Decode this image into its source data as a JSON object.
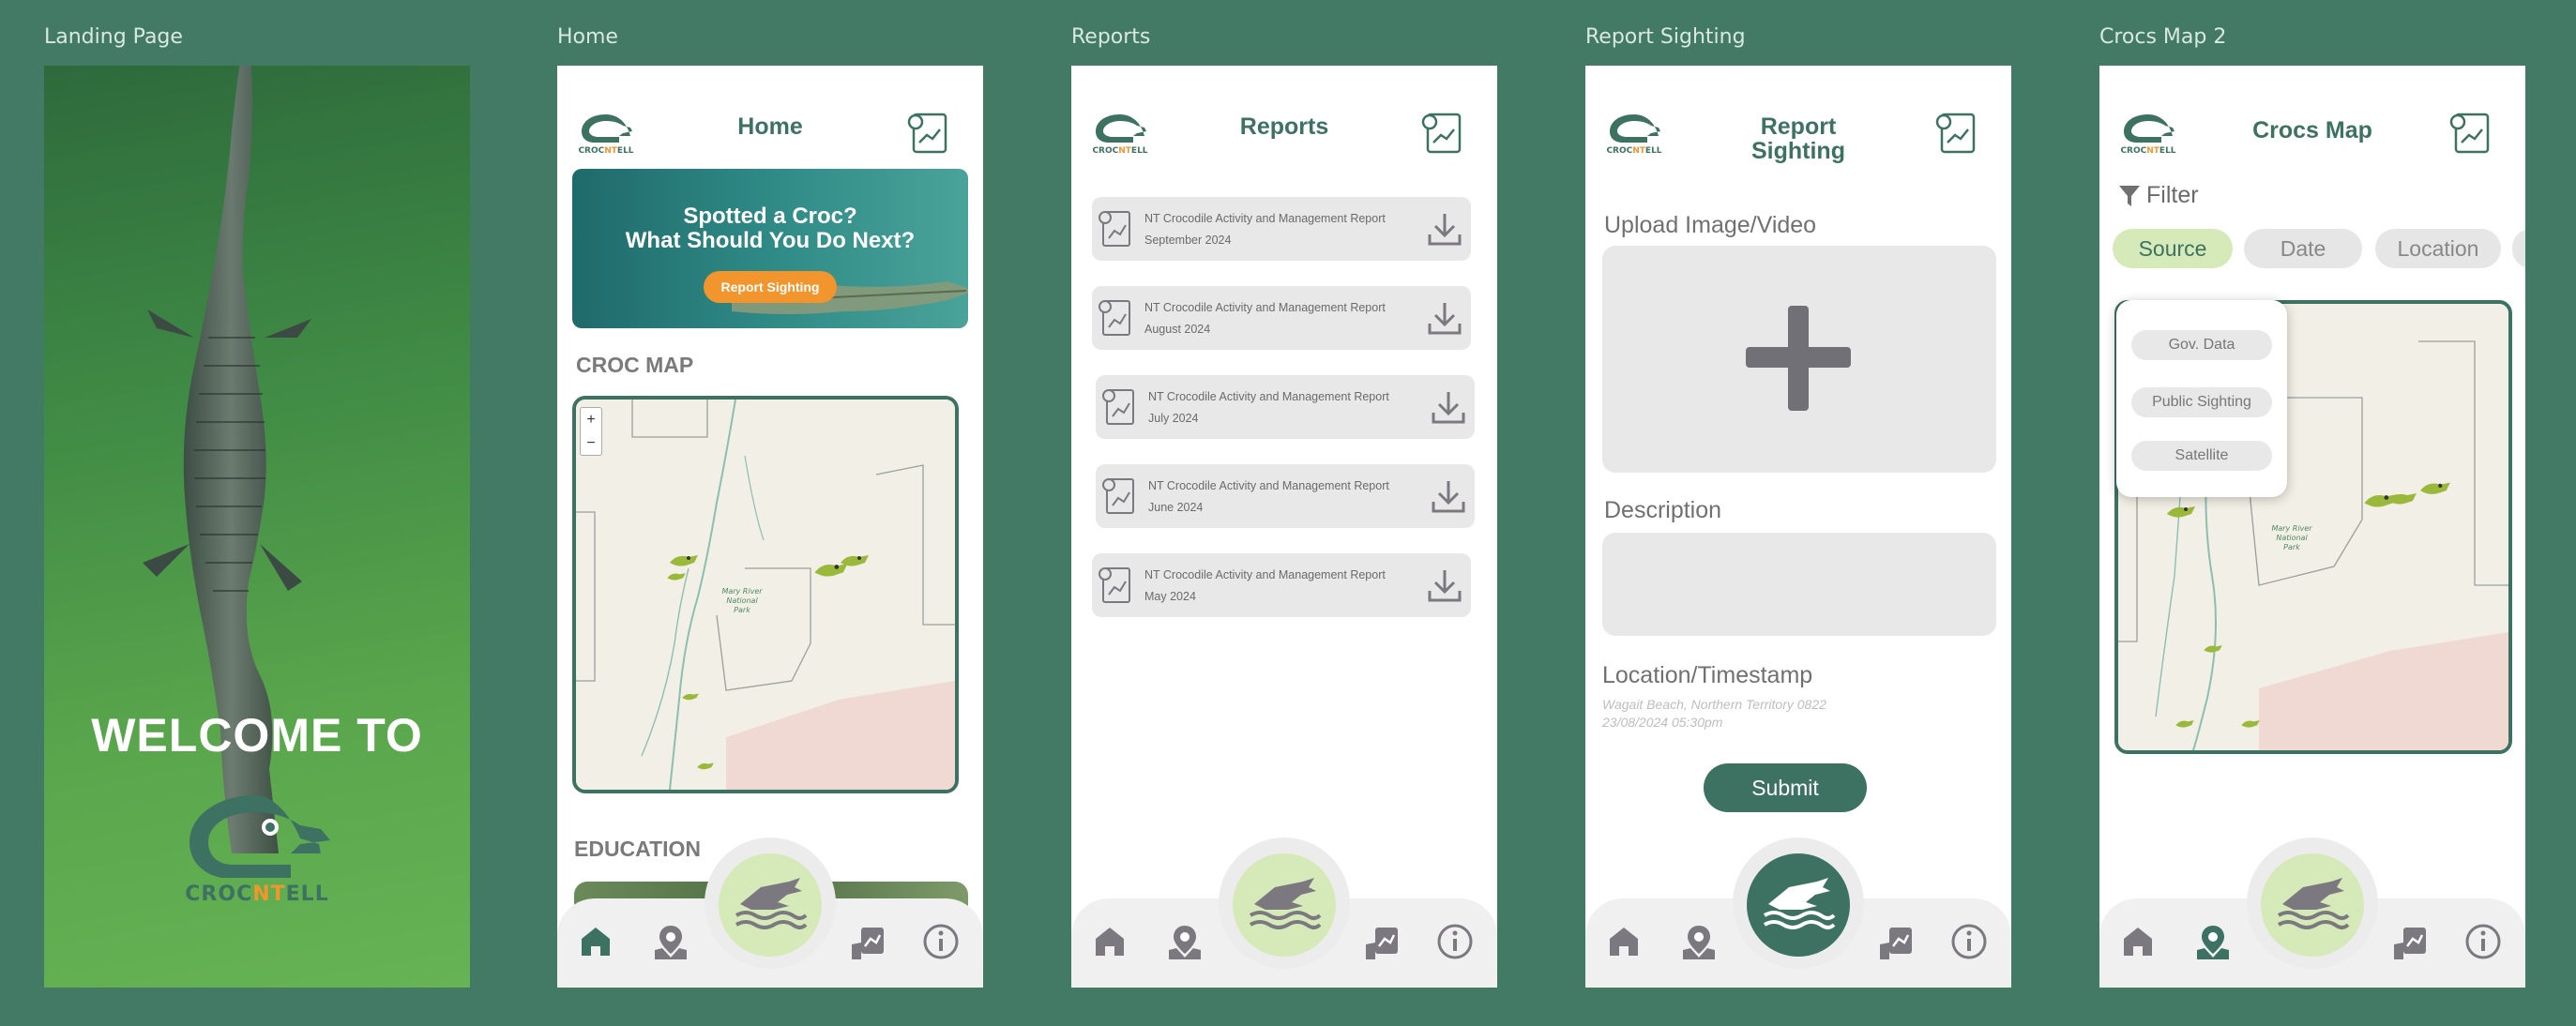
{
  "frames": {
    "landing": {
      "label": "Landing Page",
      "welcome": "WELCOME TO",
      "logo": "croc-nt-ell-logo"
    },
    "home": {
      "label": "Home",
      "title": "Home",
      "banner": {
        "line1": "Spotted a Croc?",
        "line2": "What Should You Do Next?",
        "button": "Report Sighting"
      },
      "croc_map_title": "CROC MAP",
      "map": {
        "zoom_in": "+",
        "zoom_out": "−",
        "park_label": "Mary River National Park"
      },
      "education_title": "EDUCATION"
    },
    "reports": {
      "label": "Reports",
      "title": "Reports",
      "items": [
        {
          "title": "NT Crocodile Activity and Management Report",
          "date": "September 2024"
        },
        {
          "title": "NT Crocodile Activity and Management Report",
          "date": "August 2024"
        },
        {
          "title": "NT Crocodile Activity and Management Report",
          "date": "July 2024"
        },
        {
          "title": "NT Crocodile Activity and Management Report",
          "date": "June 2024"
        },
        {
          "title": "NT Crocodile Activity and Management Report",
          "date": "May 2024"
        }
      ]
    },
    "report_sighting": {
      "label": "Report Sighting",
      "title_line1": "Report",
      "title_line2": "Sighting",
      "upload_label": "Upload Image/Video",
      "description_label": "Description",
      "location_label": "Location/Timestamp",
      "location_value": "Wagait Beach, Northern Territory 0822",
      "timestamp_value": "23/08/2024 05:30pm",
      "submit": "Submit"
    },
    "crocs_map": {
      "label": "Crocs Map 2",
      "title": "Crocs Map",
      "filter": "Filter",
      "pills": [
        "Source",
        "Date",
        "Location"
      ],
      "active_pill": "Source",
      "dropdown": [
        "Gov. Data",
        "Public Sighting",
        "Satellite"
      ],
      "park_label": "Mary River National Park"
    }
  },
  "nav": {
    "icons": [
      "home-icon",
      "map-pin-icon",
      "croc-center-icon",
      "report-pin-icon",
      "info-icon"
    ]
  },
  "colors": {
    "background": "#427a66",
    "brand": "#3d7263",
    "accent": "#f2952d",
    "light_green": "#d6e9b8"
  }
}
